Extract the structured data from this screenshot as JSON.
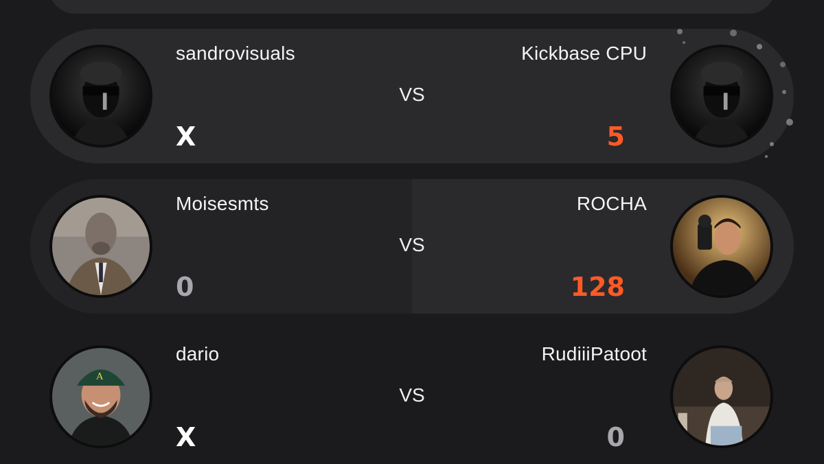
{
  "matches": [
    {
      "home": {
        "name": "sandrovisuals",
        "score": "X",
        "avatar_icon": "masked-figure-avatar"
      },
      "away": {
        "name": "Kickbase CPU",
        "score": "5",
        "avatar_icon": "masked-figure-avatar"
      },
      "vs_label": "VS",
      "highlight": "home"
    },
    {
      "home": {
        "name": "Moisesmts",
        "score": "0",
        "avatar_icon": "dog-in-suit-avatar"
      },
      "away": {
        "name": "ROCHA",
        "score": "128",
        "avatar_icon": "photographer-avatar"
      },
      "vs_label": "VS",
      "highlight": "away"
    },
    {
      "home": {
        "name": "dario",
        "score": "X",
        "avatar_icon": "man-with-cap-avatar"
      },
      "away": {
        "name": "RudiiiPatoot",
        "score": "0",
        "avatar_icon": "seated-person-avatar"
      },
      "vs_label": "VS",
      "highlight": "none"
    }
  ],
  "colors": {
    "background": "#1b1b1d",
    "card": "#2a2a2d",
    "score_highlight": "#ff5a26",
    "score_muted": "#a7a7ad"
  }
}
